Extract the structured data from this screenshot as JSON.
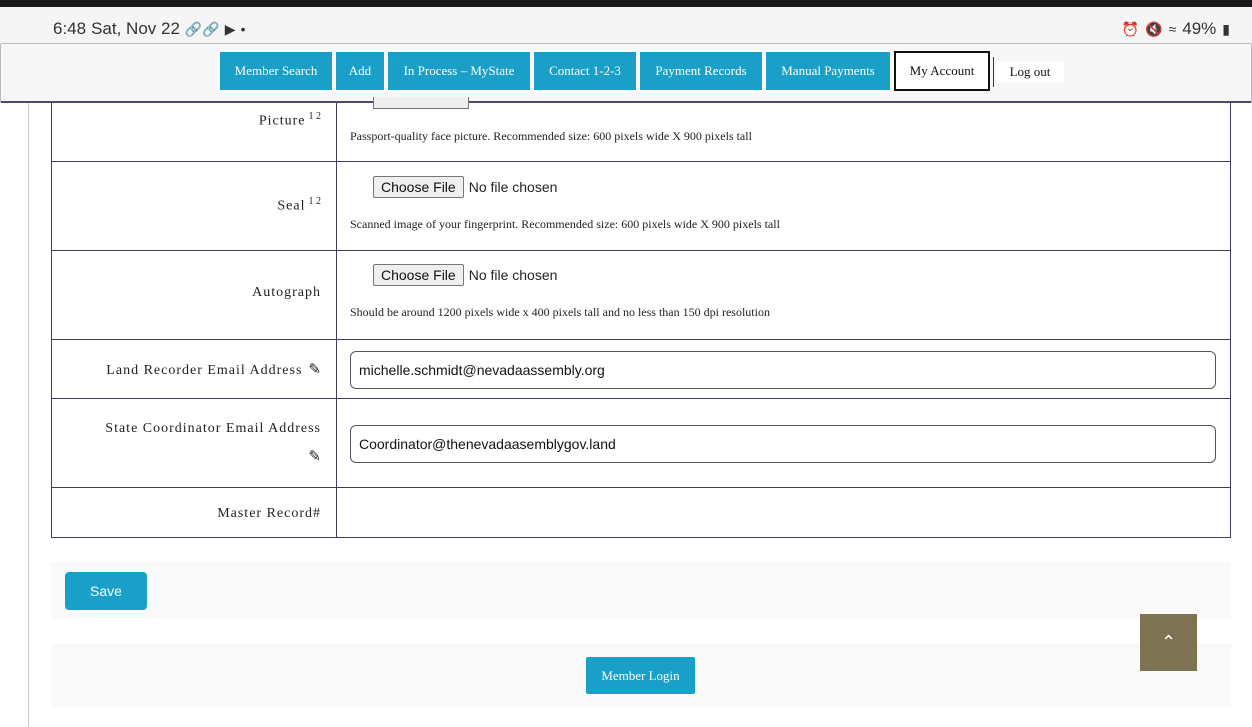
{
  "status_bar": {
    "time": "6:48",
    "date": "Sat, Nov 22",
    "battery": "49%"
  },
  "nav": {
    "items": [
      {
        "label": "Member Search"
      },
      {
        "label": "Add"
      },
      {
        "label": "In Process – MyState"
      },
      {
        "label": "Contact 1-2-3"
      },
      {
        "label": "Payment Records"
      },
      {
        "label": "Manual Payments"
      },
      {
        "label": "My Account"
      },
      {
        "label": "Log out"
      }
    ]
  },
  "form": {
    "picture": {
      "label": "Picture",
      "sup": "1 2",
      "hint": "Passport-quality face picture. Recommended size: 600 pixels wide X 900 pixels tall"
    },
    "seal": {
      "label": "Seal",
      "sup": "1 2",
      "choose": "Choose File",
      "status": "No file chosen",
      "hint": "Scanned image of your fingerprint. Recommended size: 600 pixels wide X 900 pixels tall"
    },
    "autograph": {
      "label": "Autograph",
      "choose": "Choose File",
      "status": "No file chosen",
      "hint": "Should be around 1200 pixels wide x 400 pixels tall and no less than 150 dpi resolution"
    },
    "land_recorder": {
      "label": "Land Recorder Email Address",
      "value": "michelle.schmidt@nevadaassembly.org"
    },
    "state_coordinator": {
      "label": "State Coordinator Email Address",
      "value": "Coordinator@thenevadaasemblygov.land"
    },
    "master_record": {
      "label": "Master Record#",
      "value": ""
    }
  },
  "actions": {
    "save": "Save",
    "member_login": "Member Login"
  },
  "icons": {
    "pencil": "pencil-icon",
    "scroll_top": "chevron-up-icon"
  },
  "colors": {
    "accent": "#1aa0c8",
    "scroll_top_bg": "#7d7353"
  }
}
